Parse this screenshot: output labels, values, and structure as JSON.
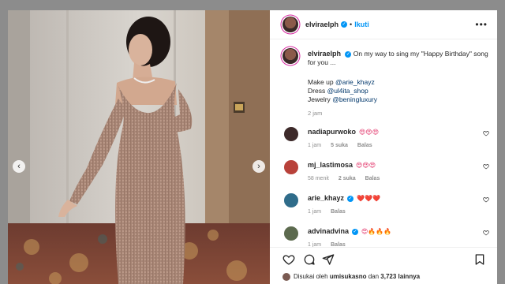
{
  "post": {
    "author": "elvirael​ph",
    "follow_label": "Ikuti",
    "separator": "•",
    "more_label": "•••"
  },
  "caption": {
    "author": "elvirael​ph",
    "text": "On my way to sing my \"Happy Birthday\" song for you ...",
    "credits": [
      {
        "label": "Make up ",
        "handle": "@arie_khayz"
      },
      {
        "label": "Dress ",
        "handle": "@ul4ita_shop"
      },
      {
        "label": "Jewelry ",
        "handle": "@beningluxury"
      }
    ],
    "time": "2 jam"
  },
  "comments": [
    {
      "user": "nadiapurwoko",
      "text": "😍😍😍",
      "time": "1 jam",
      "likes": "5 suka",
      "reply": "Balas",
      "avatar_color": "#3d2a2a"
    },
    {
      "user": "mj_lastimosa",
      "text": "😍😍😍",
      "time": "58 menit",
      "likes": "2 suka",
      "reply": "Balas",
      "avatar_color": "#b8413a"
    },
    {
      "user": "arie_khayz",
      "text": "❤️❤️❤️",
      "time": "1 jam",
      "likes": "",
      "reply": "Balas",
      "avatar_color": "#2f6c8a"
    },
    {
      "user": "advinadvina",
      "text": "😍🔥🔥🔥",
      "time": "1 jam",
      "likes": "",
      "reply": "Balas",
      "avatar_color": "#5c6a4e"
    }
  ],
  "likes": {
    "prefix": "Disukai oleh ",
    "user": "umisukasno",
    "middle": " dan ",
    "count": "3,723 lainnya"
  },
  "icons": {
    "prev": "chevron-left-icon",
    "next": "chevron-right-icon",
    "like": "heart-icon",
    "comment": "comment-icon",
    "share": "paper-plane-icon",
    "save": "bookmark-icon"
  },
  "colors": {
    "accent": "#0095f6",
    "mention": "#00376b",
    "muted": "#8e8e8e"
  }
}
